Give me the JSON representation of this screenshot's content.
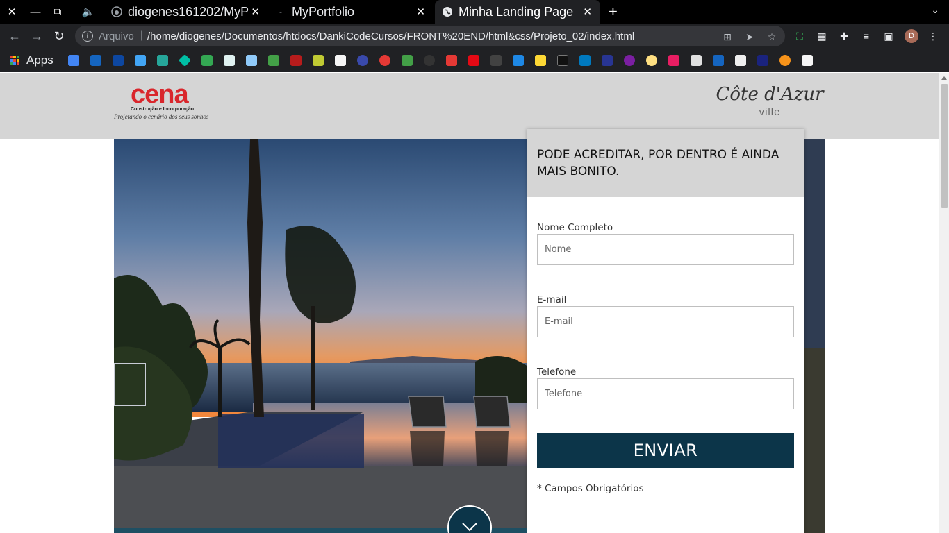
{
  "browser": {
    "tabs": [
      {
        "title": "diogenes161202/MyP",
        "icon": "github-icon"
      },
      {
        "title": "MyPortfolio",
        "icon": "page-icon"
      },
      {
        "title": "Minha Landing Page",
        "icon": "globe-icon",
        "active": true
      }
    ],
    "omnibox": {
      "scheme": "Arquivo",
      "url": "/home/diogenes/Documentos/htdocs/DankiCodeCursos/FRONT%20END/html&css/Projeto_02/index.html"
    },
    "profile_initial": "D",
    "bookmarks_label": "Apps"
  },
  "page": {
    "header": {
      "left_logo": {
        "word": "cena",
        "sub": "Construção e Incorporação",
        "slogan": "Projetando o cenário dos seus sonhos"
      },
      "right_logo": {
        "script": "Côte d'Azur",
        "ville": "ville"
      }
    },
    "form": {
      "title": "PODE ACREDITAR, POR DENTRO É AINDA MAIS BONITO.",
      "fields": [
        {
          "label": "Nome Completo",
          "placeholder": "Nome",
          "value": ""
        },
        {
          "label": "E-mail",
          "placeholder": "E-mail",
          "value": ""
        },
        {
          "label": "Telefone",
          "placeholder": "Telefone",
          "value": ""
        }
      ],
      "submit_label": "ENVIAR",
      "required_note": "* Campos Obrigatórios"
    },
    "colors": {
      "accent": "#0c3549",
      "header_bg": "#d5d5d5",
      "brand_red": "#d9262c"
    }
  }
}
